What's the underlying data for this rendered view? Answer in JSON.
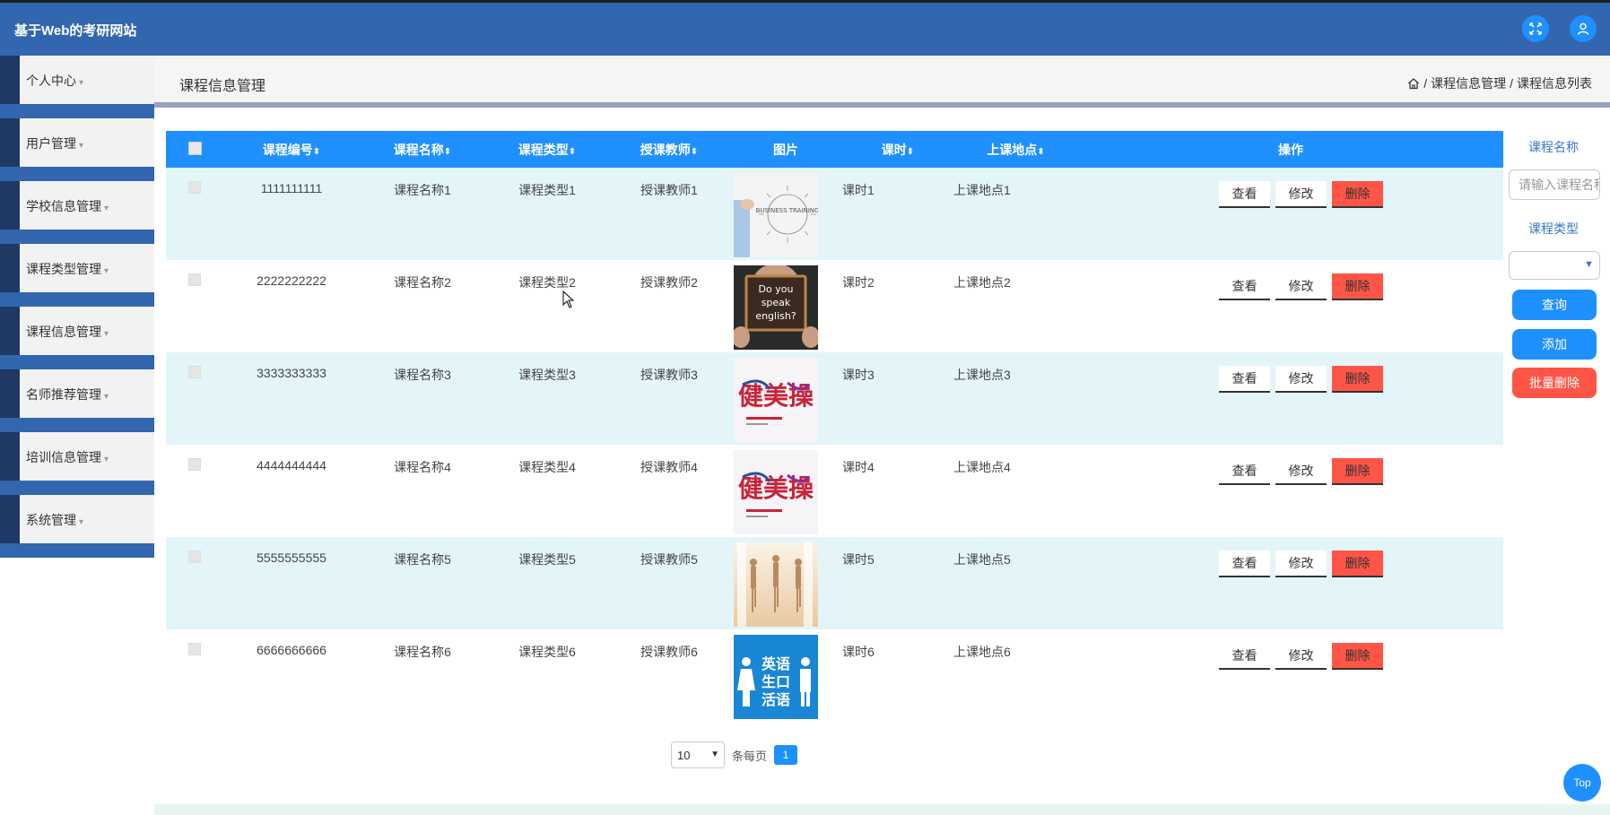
{
  "header": {
    "title": "基于Web的考研网站"
  },
  "sidebar": {
    "items": [
      {
        "label": "个人中心"
      },
      {
        "label": "用户管理"
      },
      {
        "label": "学校信息管理"
      },
      {
        "label": "课程类型管理"
      },
      {
        "label": "课程信息管理"
      },
      {
        "label": "名师推荐管理"
      },
      {
        "label": "培训信息管理"
      },
      {
        "label": "系统管理"
      }
    ],
    "caret": "▾"
  },
  "page": {
    "title": "课程信息管理",
    "breadcrumb": [
      "课程信息管理",
      "课程信息列表"
    ],
    "breadcrumb_sep": "/"
  },
  "table": {
    "columns": [
      "课程编号",
      "课程名称",
      "课程类型",
      "授课教师",
      "图片",
      "课时",
      "上课地点",
      "操作"
    ],
    "sort_icon": "⬍",
    "rows": [
      {
        "id": "1111111111",
        "name": "课程名称1",
        "type": "课程类型1",
        "teacher": "授课教师1",
        "hours": "课时1",
        "place": "上课地点1",
        "image": "business-training"
      },
      {
        "id": "2222222222",
        "name": "课程名称2",
        "type": "课程类型2",
        "teacher": "授课教师2",
        "hours": "课时2",
        "place": "上课地点2",
        "image": "do-you-speak-english"
      },
      {
        "id": "3333333333",
        "name": "课程名称3",
        "type": "课程类型3",
        "teacher": "授课教师3",
        "hours": "课时3",
        "place": "上课地点3",
        "image": "calligraphy-poster"
      },
      {
        "id": "4444444444",
        "name": "课程名称4",
        "type": "课程类型4",
        "teacher": "授课教师4",
        "hours": "课时4",
        "place": "上课地点4",
        "image": "calligraphy-poster"
      },
      {
        "id": "5555555555",
        "name": "课程名称5",
        "type": "课程类型5",
        "teacher": "授课教师5",
        "hours": "课时5",
        "place": "上课地点5",
        "image": "dancers"
      },
      {
        "id": "6666666666",
        "name": "课程名称6",
        "type": "课程类型6",
        "teacher": "授课教师6",
        "hours": "课时6",
        "place": "上课地点6",
        "image": "english-signage"
      }
    ],
    "actions": {
      "view": "查看",
      "edit": "修改",
      "delete": "删除"
    }
  },
  "search_panel": {
    "name_label": "课程名称",
    "name_placeholder": "请输入课程名称",
    "type_label": "课程类型",
    "type_value": "",
    "query_button": "查询",
    "add_button": "添加",
    "batch_delete_button": "批量删除"
  },
  "pagination": {
    "page_size": "10",
    "page_size_suffix": "条每页",
    "current_page": "1"
  },
  "image_texts": {
    "business_training": "BUSINESS TRAINING",
    "speak_english": "Do you speak english?",
    "calligraphy": "健美操",
    "english_sign": [
      "英语",
      "生口",
      "活语"
    ]
  },
  "top_button": "Top",
  "colors": {
    "header": "#3266ae",
    "table_header": "#1e90ff",
    "row_highlight": "#e3f5f9",
    "delete": "#ff5547",
    "batch_delete": "#ff5547"
  }
}
